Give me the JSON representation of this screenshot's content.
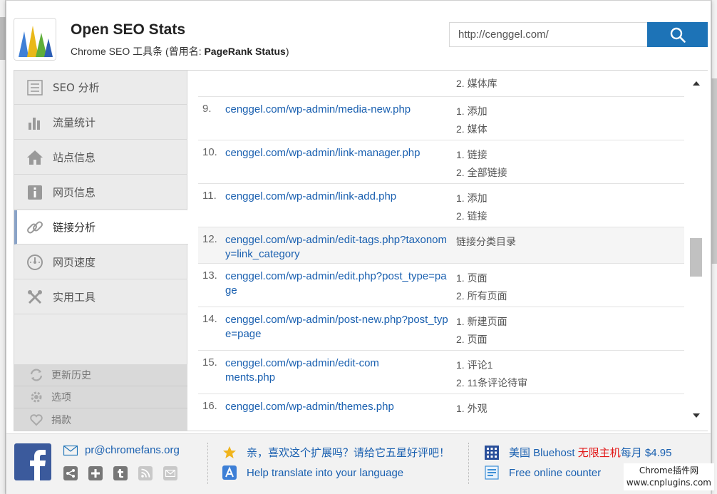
{
  "header": {
    "title": "Open SEO Stats",
    "subtitle_prefix": "Chrome SEO 工具条 (曾用名: ",
    "subtitle_bold": "PageRank Status",
    "subtitle_suffix": ")",
    "url_value": "http://cenggel.com/",
    "search_icon": "search-icon"
  },
  "sidebar": {
    "items": [
      {
        "label": "SEO 分析",
        "icon": "list-icon"
      },
      {
        "label": "流量统计",
        "icon": "bar-chart-icon"
      },
      {
        "label": "站点信息",
        "icon": "home-icon"
      },
      {
        "label": "网页信息",
        "icon": "info-icon"
      },
      {
        "label": "链接分析",
        "icon": "link-icon",
        "active": true
      },
      {
        "label": "网页速度",
        "icon": "speedometer-icon"
      },
      {
        "label": "实用工具",
        "icon": "tools-icon"
      }
    ],
    "sub_items": [
      {
        "label": "更新历史",
        "icon": "refresh-icon"
      },
      {
        "label": "选项",
        "icon": "gear-icon"
      },
      {
        "label": "捐款",
        "icon": "heart-icon"
      }
    ]
  },
  "links": [
    {
      "num": "",
      "url": "",
      "menus": [
        "2. 媒体库"
      ]
    },
    {
      "num": "9.",
      "url": "cenggel.com/wp-admin/media-new.php",
      "menus": [
        "1. 添加",
        "2. 媒体"
      ]
    },
    {
      "num": "10.",
      "url": "cenggel.com/wp-admin/link-manager.php",
      "menus": [
        "1. 链接",
        "2. 全部链接"
      ]
    },
    {
      "num": "11.",
      "url": "cenggel.com/wp-admin/link-add.php",
      "menus": [
        "1. 添加",
        "2. 链接"
      ]
    },
    {
      "num": "12.",
      "url": "cenggel.com/wp-admin/edit-tags.php?taxonomy=link_category",
      "menus": [
        "链接分类目录"
      ]
    },
    {
      "num": "13.",
      "url": "cenggel.com/wp-admin/edit.php?post_type=page",
      "menus": [
        "1. 页面",
        "2. 所有页面"
      ]
    },
    {
      "num": "14.",
      "url": "cenggel.com/wp-admin/post-new.php?post_type=page",
      "menus": [
        "1. 新建页面",
        "2. 页面"
      ]
    },
    {
      "num": "15.",
      "url": "cenggel.com/wp-admin/edit-comments.php",
      "menus": [
        "1. 评论1",
        "2. 11条评论待审"
      ]
    },
    {
      "num": "16.",
      "url": "cenggel.com/wp-admin/themes.php",
      "menus": [
        "1. 外观"
      ]
    }
  ],
  "footer": {
    "email": "pr@chromefans.org",
    "share_icons": [
      "share-icon",
      "plus-icon",
      "tumblr-icon",
      "rss-icon",
      "mail-icon"
    ],
    "rate_text": "亲，喜欢这个扩展吗？请给它五星好评吧！",
    "translate_text": "Help translate into your language",
    "bluehost_prefix": "美国 Bluehost ",
    "bluehost_red": "无限主机",
    "bluehost_suffix": "每月 $4.95",
    "counter_text": "Free online counter"
  },
  "watermark": {
    "line1": "Chrome插件网",
    "line2": "www.cnplugins.com"
  },
  "colors": {
    "accent": "#1d73b7",
    "link": "#1a60b0",
    "highlight_red": "#e21818"
  }
}
